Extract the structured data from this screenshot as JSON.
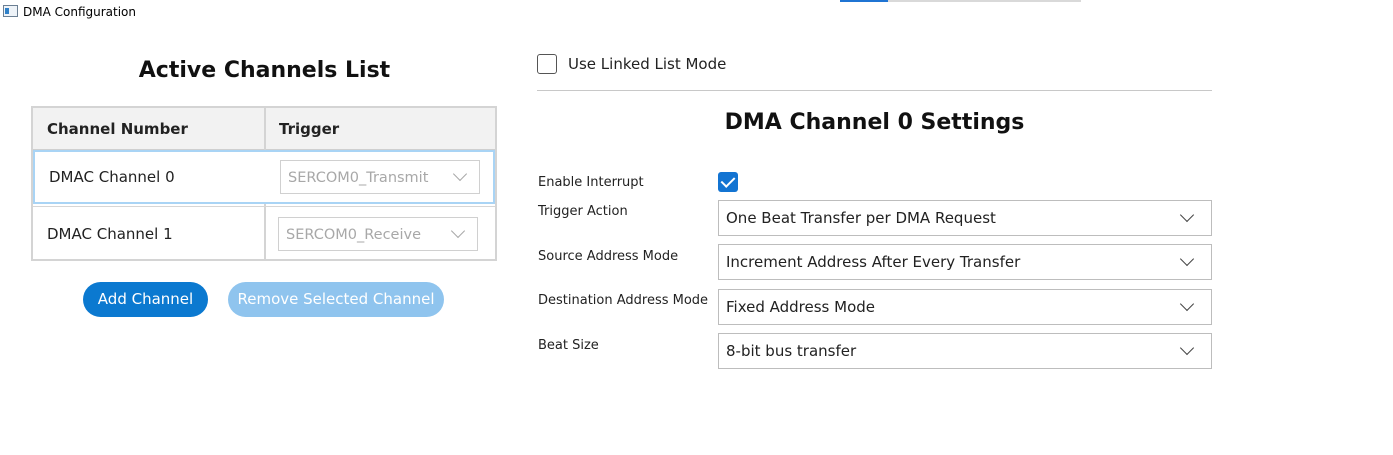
{
  "window": {
    "title": "DMA Configuration"
  },
  "channels_panel": {
    "title": "Active Channels List",
    "columns": [
      "Channel Number",
      "Trigger"
    ],
    "rows": [
      {
        "name": "DMAC Channel 0",
        "trigger": "SERCOM0_Transmit",
        "selected": true
      },
      {
        "name": "DMAC Channel 1",
        "trigger": "SERCOM0_Receive",
        "selected": false
      }
    ],
    "add_button": "Add Channel",
    "remove_button": "Remove Selected Channel"
  },
  "settings": {
    "linked_list_label": "Use Linked List Mode",
    "linked_list_checked": false,
    "title": "DMA Channel 0 Settings",
    "enable_interrupt_label": "Enable Interrupt",
    "enable_interrupt_checked": true,
    "trigger_action": {
      "label": "Trigger Action",
      "value": "One Beat Transfer per DMA Request"
    },
    "source_address_mode": {
      "label": "Source Address Mode",
      "value": "Increment Address After Every Transfer"
    },
    "destination_address_mode": {
      "label": "Destination Address Mode",
      "value": "Fixed Address Mode"
    },
    "beat_size": {
      "label": "Beat Size",
      "value": "8-bit bus transfer"
    }
  },
  "colors": {
    "accent": "#0b79d0",
    "accent_disabled": "#8fc4ee",
    "selected_row_border": "#a9d4f5"
  }
}
